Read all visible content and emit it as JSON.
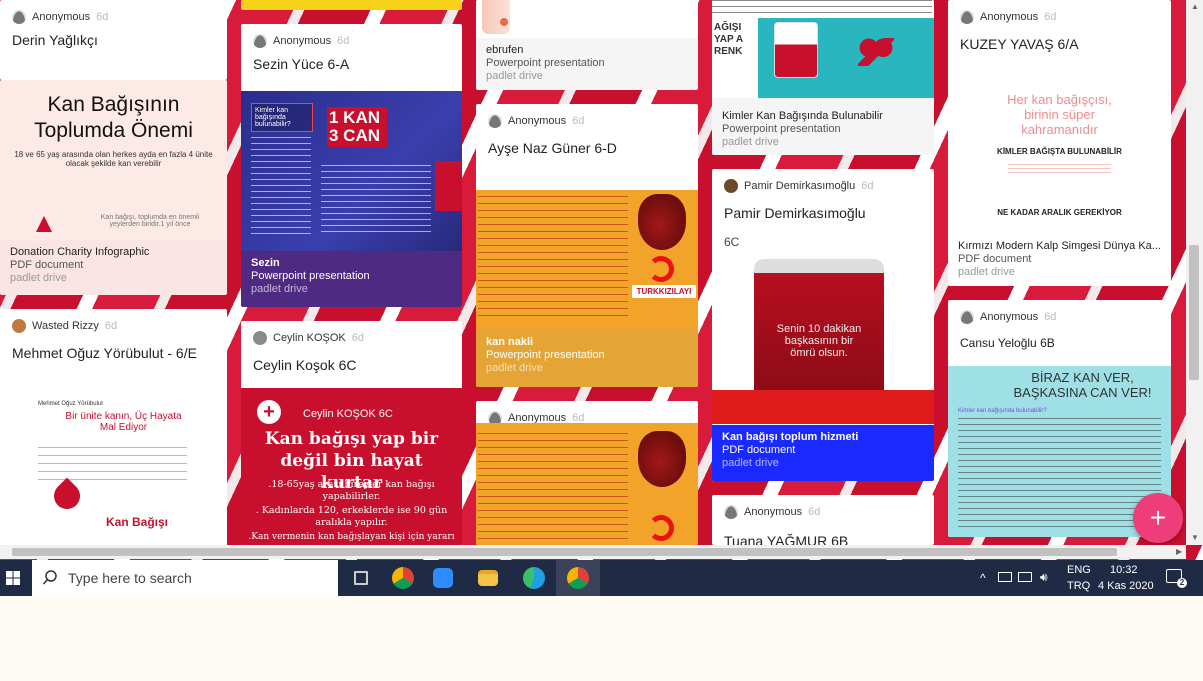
{
  "cards": {
    "c1a": {
      "author": "Anonymous",
      "age": "6d",
      "title": "Derin Yağlıkçı"
    },
    "c1b": {
      "img_title": "Kan Bağışının Toplumda Önemi",
      "img_sub": "18 ve 65 yaş arasında olan herkes ayda en fazla 4 ünite olacak şekilde kan verebilir",
      "img_caption": "Kan bağışı, toplumda en önemli yeylerden biridir.1 yıl önce",
      "att_title": "Donation Charity Infographic",
      "att_type": "PDF document",
      "att_src": "padlet drive"
    },
    "c1c": {
      "author": "Wasted Rizzy",
      "age": "6d",
      "title": "Mehmet Oğuz Yörübulut - 6/E",
      "img_name": "Mehmet Oğuz Yörübulut",
      "img_heading": "Bir ünite kanın, Üç Hayata Mal Ediyor",
      "img_footer": "Kan Bağışı"
    },
    "c2a": {
      "author": "Anonymous",
      "age": "6d",
      "title": "Sezin Yüce 6-A",
      "img_logo": "1 KAN 3 CAN",
      "img_q1": "Kimler kan bağışında bulunabilir?",
      "att_title": "Sezin",
      "att_type": "Powerpoint presentation",
      "att_src": "padlet drive"
    },
    "c2b": {
      "author": "Ceylin KOŞOK",
      "age": "6d",
      "title": "Ceylin Koşok 6C",
      "img_name": "Ceylin KOŞOK 6C",
      "img_heading": "Kan bağışı yap bir değil bin hayat kurtar",
      "img_l1": ".18-65yaş arası bireyler kan bağışı yapabilirler.",
      "img_l2": ". Kadınlarda 120, erkeklerde ise 90 gün aralıkla yapılır.",
      "img_l3": ".Kan vermenin kan bağışlayan kişi için yararı"
    },
    "c3a": {
      "att_title": "ebrufen",
      "att_type": "Powerpoint presentation",
      "att_src": "padlet drive"
    },
    "c3b": {
      "author": "Anonymous",
      "age": "6d",
      "title": "Ayşe Naz Güner 6-D",
      "img_brand": "TURKKIZILAYI",
      "att_title": "kan nakli",
      "att_type": "Powerpoint presentation",
      "att_src": "padlet drive"
    },
    "c3c": {
      "author": "Anonymous",
      "age": "6d"
    },
    "c4a": {
      "img_text": "AĞIŞI YAP A RENK",
      "att_title": "Kimler Kan Bağışında Bulunabilir",
      "att_type": "Powerpoint presentation",
      "att_src": "padlet drive"
    },
    "c4b": {
      "author": "Pamir Demirkasımoğlu",
      "age": "6d",
      "title": "Pamir Demirkasımoğlu",
      "subtitle": "6C",
      "img_bag": "Senin 10 dakikan başkasının bir ömrü olsun.",
      "att_title": "Kan bağışı toplum hizmeti",
      "att_type": "PDF document",
      "att_src": "padlet drive"
    },
    "c4c": {
      "author": "Anonymous",
      "age": "6d",
      "title": "Tuana YAĞMUR 6B"
    },
    "c5a": {
      "author": "Anonymous",
      "age": "6d",
      "title": "KUZEY YAVAŞ 6/A",
      "img_l1": "Her kan bağışçısı, birinin süper kahramanıdır",
      "img_l2": "KİMLER BAĞIŞTA BULUNABİLİR",
      "img_l3": "NE KADAR ARALIK GEREKİYOR",
      "att_title": "Kırmızı Modern Kalp Simgesi Dünya Ka...",
      "att_type": "PDF document",
      "att_src": "padlet drive"
    },
    "c5b": {
      "author": "Anonymous",
      "age": "6d",
      "title": "Cansu Yeloğlu 6B",
      "img_heading": "BİRAZ KAN VER, BAŞKASINA CAN VER!",
      "img_q": "Kimler kan bağışında bulunabilir?"
    }
  },
  "fab": "+",
  "taskbar": {
    "search_placeholder": "Type here to search",
    "lang": "ENG",
    "lang2": "TRQ",
    "time": "10:32",
    "date": "4 Kas 2020",
    "notif_count": "2"
  }
}
